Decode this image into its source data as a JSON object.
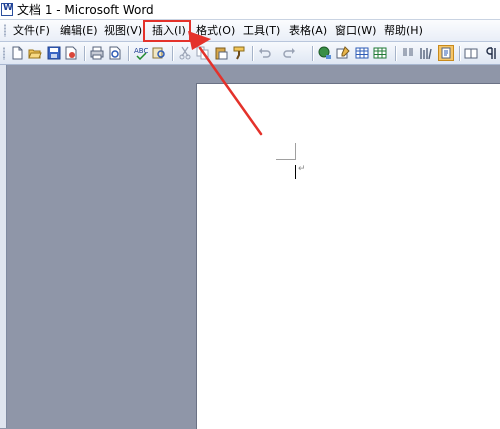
{
  "window": {
    "title": "文档 1 - Microsoft Word"
  },
  "menubar": {
    "items": [
      {
        "label": "文件(F)"
      },
      {
        "label": "编辑(E)"
      },
      {
        "label": "视图(V)"
      },
      {
        "label": "插入(I)"
      },
      {
        "label": "格式(O)"
      },
      {
        "label": "工具(T)"
      },
      {
        "label": "表格(A)"
      },
      {
        "label": "窗口(W)"
      },
      {
        "label": "帮助(H)"
      }
    ],
    "highlighted": "插入(I)"
  },
  "toolbar": {
    "icons": [
      "new-document-icon",
      "open-folder-icon",
      "save-icon",
      "permission-icon",
      "print-icon",
      "print-preview-icon",
      "spelling-icon",
      "research-icon",
      "cut-icon",
      "copy-icon",
      "paste-icon",
      "format-painter-icon",
      "undo-icon",
      "redo-icon",
      "hyperlink-icon",
      "tables-borders-icon",
      "insert-table-icon",
      "insert-excel-icon",
      "columns-icon",
      "drawing-icon",
      "document-map-icon",
      "show-formatting-icon",
      "read-icon"
    ]
  },
  "document": {
    "paragraph_mark": "↵"
  },
  "colors": {
    "annotation": "#e4322b",
    "workspace": "#8f96a8",
    "page": "#ffffff"
  }
}
